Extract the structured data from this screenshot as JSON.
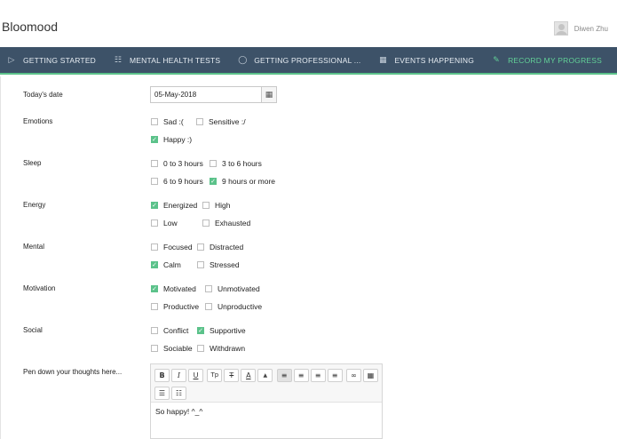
{
  "app": {
    "brand": "Bloomood"
  },
  "user": {
    "name": "Diwen Zhu"
  },
  "nav": {
    "items": [
      {
        "label": "GETTING STARTED",
        "icon": "play-icon"
      },
      {
        "label": "MENTAL HEALTH TESTS",
        "icon": "clipboard-icon"
      },
      {
        "label": "GETTING PROFESSIONAL ...",
        "icon": "compass-icon"
      },
      {
        "label": "EVENTS HAPPENING",
        "icon": "calendar-icon"
      },
      {
        "label": "RECORD MY PROGRESS",
        "icon": "pencil-icon",
        "active": true
      }
    ],
    "more_icon": "⋮"
  },
  "form": {
    "date": {
      "label": "Today's date",
      "value": "05-May-2018",
      "icon": "calendar-icon"
    },
    "emotions": {
      "label": "Emotions",
      "options": [
        {
          "label": "Sad :(",
          "checked": false
        },
        {
          "label": "Sensitive :/",
          "checked": false
        },
        {
          "label": "Happy :)",
          "checked": true
        }
      ]
    },
    "sleep": {
      "label": "Sleep",
      "options": [
        {
          "label": "0 to 3 hours",
          "checked": false
        },
        {
          "label": "3 to 6 hours",
          "checked": false
        },
        {
          "label": "6 to 9 hours",
          "checked": false
        },
        {
          "label": "9 hours or more",
          "checked": true
        }
      ]
    },
    "energy": {
      "label": "Energy",
      "options": [
        {
          "label": "Energized",
          "checked": true
        },
        {
          "label": "High",
          "checked": false
        },
        {
          "label": "Low",
          "checked": false
        },
        {
          "label": "Exhausted",
          "checked": false
        }
      ]
    },
    "mental": {
      "label": "Mental",
      "options": [
        {
          "label": "Focused",
          "checked": false
        },
        {
          "label": "Distracted",
          "checked": false
        },
        {
          "label": "Calm",
          "checked": true
        },
        {
          "label": "Stressed",
          "checked": false
        }
      ]
    },
    "motivation": {
      "label": "Motivation",
      "options": [
        {
          "label": "Motivated",
          "checked": true
        },
        {
          "label": "Unmotivated",
          "checked": false
        },
        {
          "label": "Productive",
          "checked": false
        },
        {
          "label": "Unproductive",
          "checked": false
        }
      ]
    },
    "social": {
      "label": "Social",
      "options": [
        {
          "label": "Conflict",
          "checked": false
        },
        {
          "label": "Supportive",
          "checked": true
        },
        {
          "label": "Sociable",
          "checked": false
        },
        {
          "label": "Withdrawn",
          "checked": false
        }
      ]
    },
    "thoughts": {
      "label": "Pen down your thoughts here...",
      "content": "So happy! ^_^",
      "toolbar": {
        "bold": "B",
        "italic": "I",
        "underline": "U",
        "clear_format": "Tp",
        "remove_format": "T",
        "font_color": "A",
        "highlight": "▲",
        "align_left": "≡",
        "align_center": "≡",
        "align_right": "≡",
        "justify": "≡",
        "link": "∞",
        "table": "▦",
        "bullet_list": "☰",
        "numbered_list": "☷"
      }
    }
  },
  "colors": {
    "nav_bg": "#3d5268",
    "accent": "#5bc28a"
  }
}
